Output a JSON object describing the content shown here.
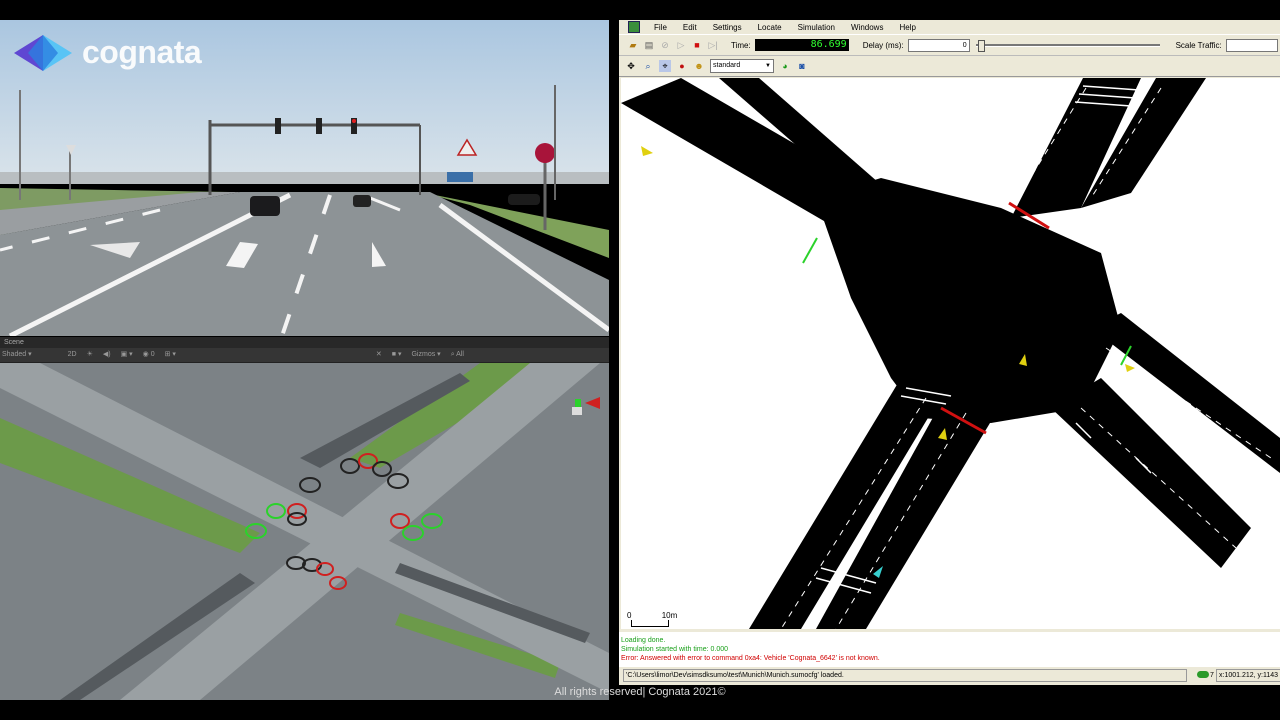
{
  "overlay": {
    "logo_text": "cognata",
    "copyright": "All rights reserved| Cognata 2021©"
  },
  "scene_panel": {
    "tab_label": "Scene",
    "shading_mode": "Shaded",
    "mode_2d": "2D",
    "gizmos_label": "Gizmos",
    "search_placeholder": "All"
  },
  "sumo": {
    "menu": [
      "File",
      "Edit",
      "Settings",
      "Locate",
      "Simulation",
      "Windows",
      "Help"
    ],
    "time_label": "Time:",
    "time_value": "86.699",
    "delay_label": "Delay (ms):",
    "delay_value": "0",
    "scale_traffic_label": "Scale Traffic:",
    "color_scheme": "standard",
    "scale_left": "0",
    "scale_right": "10m",
    "messages": [
      {
        "text": "Loading done.",
        "type": "ok"
      },
      {
        "text": "Simulation started with time: 0.000",
        "type": "ok"
      },
      {
        "text": "Error: Answered with error to command 0xa4: Vehicle 'Cognata_6642' is not known.",
        "type": "error"
      }
    ],
    "status_text": "'C:\\Users\\limor\\Dev\\simsdksumo\\test\\Munich\\Munich.sumocfg' loaded.",
    "status_count": "7",
    "coordinates": "x:1001.212, y:1143"
  },
  "colors": {
    "accent_green": "#31ff31",
    "error_red": "#d00000",
    "ok_green": "#1aa01a",
    "window_bg": "#ece9d8"
  }
}
